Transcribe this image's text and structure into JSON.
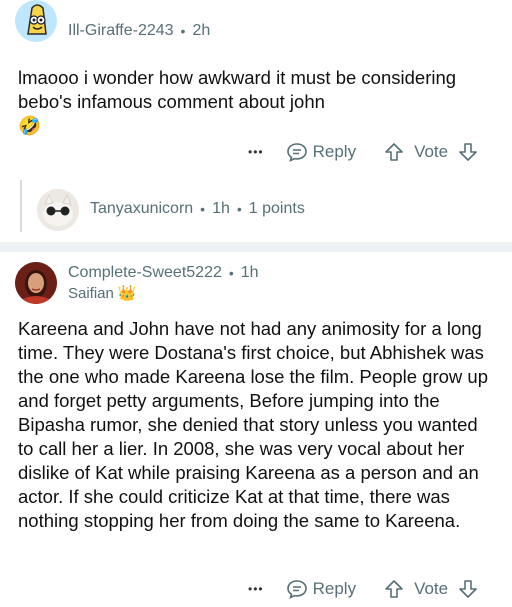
{
  "comment1": {
    "username": "Ill-Giraffe-2243",
    "time": "2h",
    "text": "lmaooo i wonder how awkward it must be considering bebo's infamous comment about john",
    "emoji": "🤣",
    "actions": {
      "more": "•••",
      "reply": "Reply",
      "vote": "Vote"
    }
  },
  "reply1": {
    "username": "Tanyaxunicorn",
    "time": "1h",
    "points": "1 points"
  },
  "comment2": {
    "username": "Complete-Sweet5222",
    "time": "1h",
    "flair": "Saifian",
    "flair_emoji": "👑",
    "text": "Kareena and John have not had any animosity for a long time. They were Dostana's first choice, but Abhishek was the one who made Kareena lose the film. People grow up and forget petty arguments, Before jumping into the Bipasha rumor, she denied that story unless you wanted to call her a lier. In 2008, she was very vocal about her dislike of Kat while praising Kareena as a person and an actor. If she could criticize Kat at that time, there was nothing stopping her from doing the same to Kareena.",
    "actions": {
      "more": "•••",
      "reply": "Reply",
      "vote": "Vote"
    }
  }
}
